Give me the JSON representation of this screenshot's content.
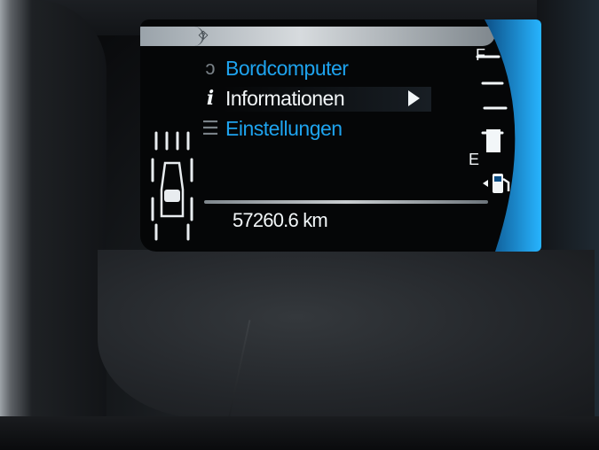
{
  "menu": {
    "items": [
      {
        "label": "Bordcomputer",
        "icon": "trip-computer-icon",
        "selected": false
      },
      {
        "label": "Informationen",
        "icon": "info-icon",
        "selected": true
      },
      {
        "label": "Einstellungen",
        "icon": "settings-list-icon",
        "selected": false
      }
    ]
  },
  "status": {
    "odometer": "57260.6 km"
  },
  "fuel_gauge": {
    "full_label": "F",
    "empty_label": "E",
    "level": 0.1
  },
  "colors": {
    "menu_blue": "#1ea3ee",
    "selected_white": "#f2f6f8",
    "gauge_blue": "#1aa6f0"
  }
}
